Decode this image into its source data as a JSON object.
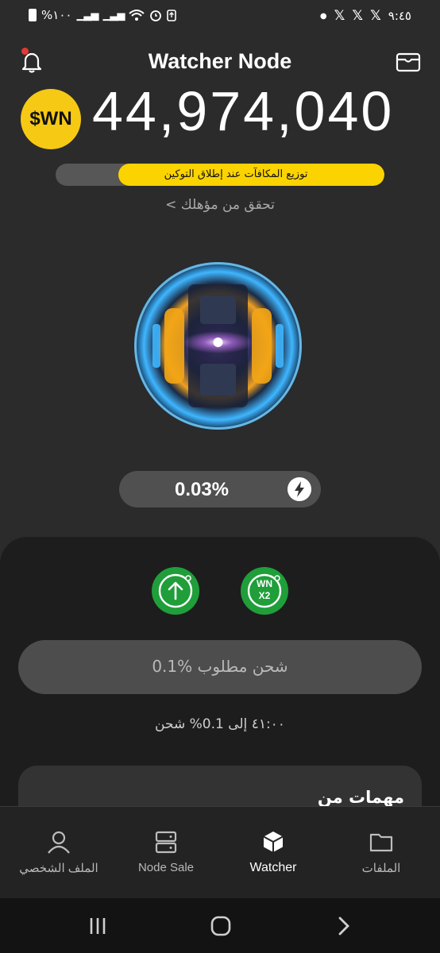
{
  "status_bar": {
    "time": "٩:٤٥",
    "battery": "%١٠٠",
    "icons": [
      "x-icon",
      "x-icon",
      "x-icon",
      "dot-icon",
      "battery-icon",
      "signal-icon",
      "wifi-icon",
      "alarm-icon",
      "upload-icon"
    ]
  },
  "header": {
    "title": "Watcher Node"
  },
  "balance": {
    "coin_label": "$WN",
    "amount": "44,974,040"
  },
  "progress": {
    "text": "توزيع المكافآت عند إطلاق التوكين",
    "fraction": 0.81
  },
  "eligibility": {
    "text": "تحقق من مؤهلك",
    "chevron": "<"
  },
  "rate": {
    "value": "0.03%"
  },
  "actions": {
    "boost_label_top": "WN",
    "boost_label_bottom": "X2"
  },
  "charge": {
    "button_text": "0.1% شحن مطلوب",
    "timer_text": "٤١:٠٠ إلى 0.1% شحن"
  },
  "tasks": {
    "title": "مهمات من"
  },
  "nav": {
    "items": [
      {
        "label": "الملف الشخصي",
        "icon": "user-icon"
      },
      {
        "label": "Node Sale",
        "icon": "server-icon"
      },
      {
        "label": "Watcher",
        "icon": "cube-icon",
        "active": true
      },
      {
        "label": "الملفات",
        "icon": "folder-icon"
      }
    ]
  },
  "colors": {
    "accent": "#fbd300",
    "green": "#1f9e3a",
    "background": "#2b2b2b"
  }
}
